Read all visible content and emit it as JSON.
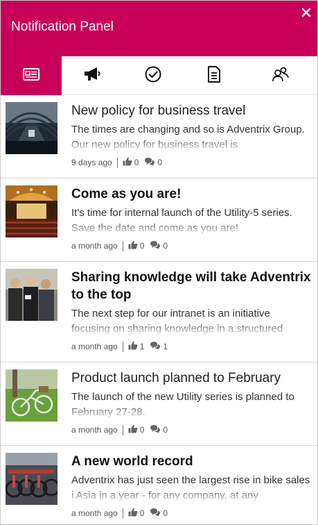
{
  "header": {
    "title": "Notification Panel",
    "close_icon": "close-icon"
  },
  "tabs": [
    {
      "icon": "news-icon",
      "active": true
    },
    {
      "icon": "megaphone-icon",
      "active": false
    },
    {
      "icon": "check-circle-icon",
      "active": false
    },
    {
      "icon": "document-icon",
      "active": false
    },
    {
      "icon": "people-icon",
      "active": false
    }
  ],
  "colors": {
    "brand": "#c8005a",
    "text": "#222222",
    "muted": "#555555"
  },
  "items": [
    {
      "title": "New policy for business travel",
      "bold": false,
      "excerpt": "The times are changing and so is Adventrix Group. Our new policy for business travel is",
      "time": "9 days ago",
      "likes": "0",
      "comments": "0",
      "image": "train-station-photo"
    },
    {
      "title": "Come as you are!",
      "bold": true,
      "excerpt": "It's time for internal launch of the Utility-5 series. Save the date and come as you are!",
      "time": "a month ago",
      "likes": "0",
      "comments": "0",
      "image": "theater-photo"
    },
    {
      "title": "Sharing knowledge will take Adventrix to the top",
      "bold": true,
      "excerpt": "The next step for our intranet is an initiative focusing on sharing knowledge in a structured",
      "time": "a month ago",
      "likes": "1",
      "comments": "1",
      "image": "people-group-photo"
    },
    {
      "title": "Product launch planned to February",
      "bold": false,
      "excerpt": "The launch of the new Utility series is planned to February 27-28.",
      "time": "a month ago",
      "likes": "0",
      "comments": "0",
      "image": "bicycle-photo"
    },
    {
      "title": "A new world record",
      "bold": true,
      "excerpt": "Adventrix has just seen the largest rise in bike sales i Asia in a year - for any company, at any",
      "time": "a month ago",
      "likes": "0",
      "comments": "0",
      "image": "bike-rack-photo"
    }
  ]
}
